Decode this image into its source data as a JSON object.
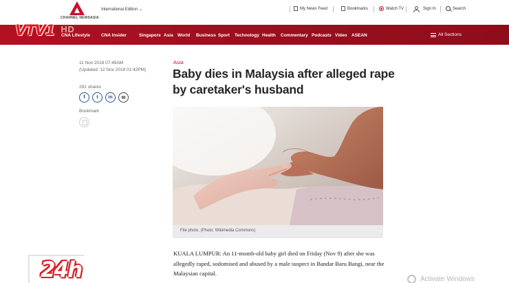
{
  "header": {
    "logo_text": "CHANNEL NEWSASIA",
    "edition": "International Edition",
    "tools": [
      {
        "label": "My News Feed",
        "icon": "news-feed-icon"
      },
      {
        "label": "Bookmarks",
        "icon": "bookmark-icon"
      },
      {
        "label": "Watch TV",
        "icon": "watch-tv-icon"
      },
      {
        "label": "Sign In",
        "icon": "user-icon"
      },
      {
        "label": "Search",
        "icon": "search-icon"
      }
    ]
  },
  "nav": {
    "items": [
      "CNA Lifestyle",
      "CNA Insider",
      "Singapore",
      "Asia",
      "World",
      "Business",
      "Sport",
      "Technology",
      "Health",
      "Commentary",
      "Podcasts",
      "Video",
      "ASEAN"
    ],
    "all_sections": "All Sections"
  },
  "overlay": {
    "channel_logo": "VTV1",
    "channel_hd": "HD",
    "corner_badge": "24h",
    "watermark": "Activate Windows"
  },
  "article": {
    "published": "11 Nov 2018 07:49AM",
    "updated": "(Updated: 12 Nov 2018 01:42PM)",
    "shares": "281 shares",
    "social": [
      {
        "label": "f",
        "icon": "facebook-icon"
      },
      {
        "label": "t",
        "icon": "twitter-icon"
      },
      {
        "label": "in",
        "icon": "linkedin-icon"
      },
      {
        "label": "✉",
        "icon": "email-icon"
      }
    ],
    "bookmark_label": "Bookmark",
    "category": "Asia",
    "headline": "Baby dies in Malaysia after alleged rape by caretaker's husband",
    "photo_caption": "File photo. (Photo: Wikimedia Commons)",
    "body": "KUALA LUMPUR: An 11-month-old baby girl died on Friday (Nov 9) after she was allegedly raped, sodomised and abused by a male suspect in Bandar Baru Bangi, near the Malaysian capital."
  },
  "colors": {
    "brand_red": "#c8102e",
    "nav_red": "#a3101f",
    "text_dark": "#262626"
  }
}
